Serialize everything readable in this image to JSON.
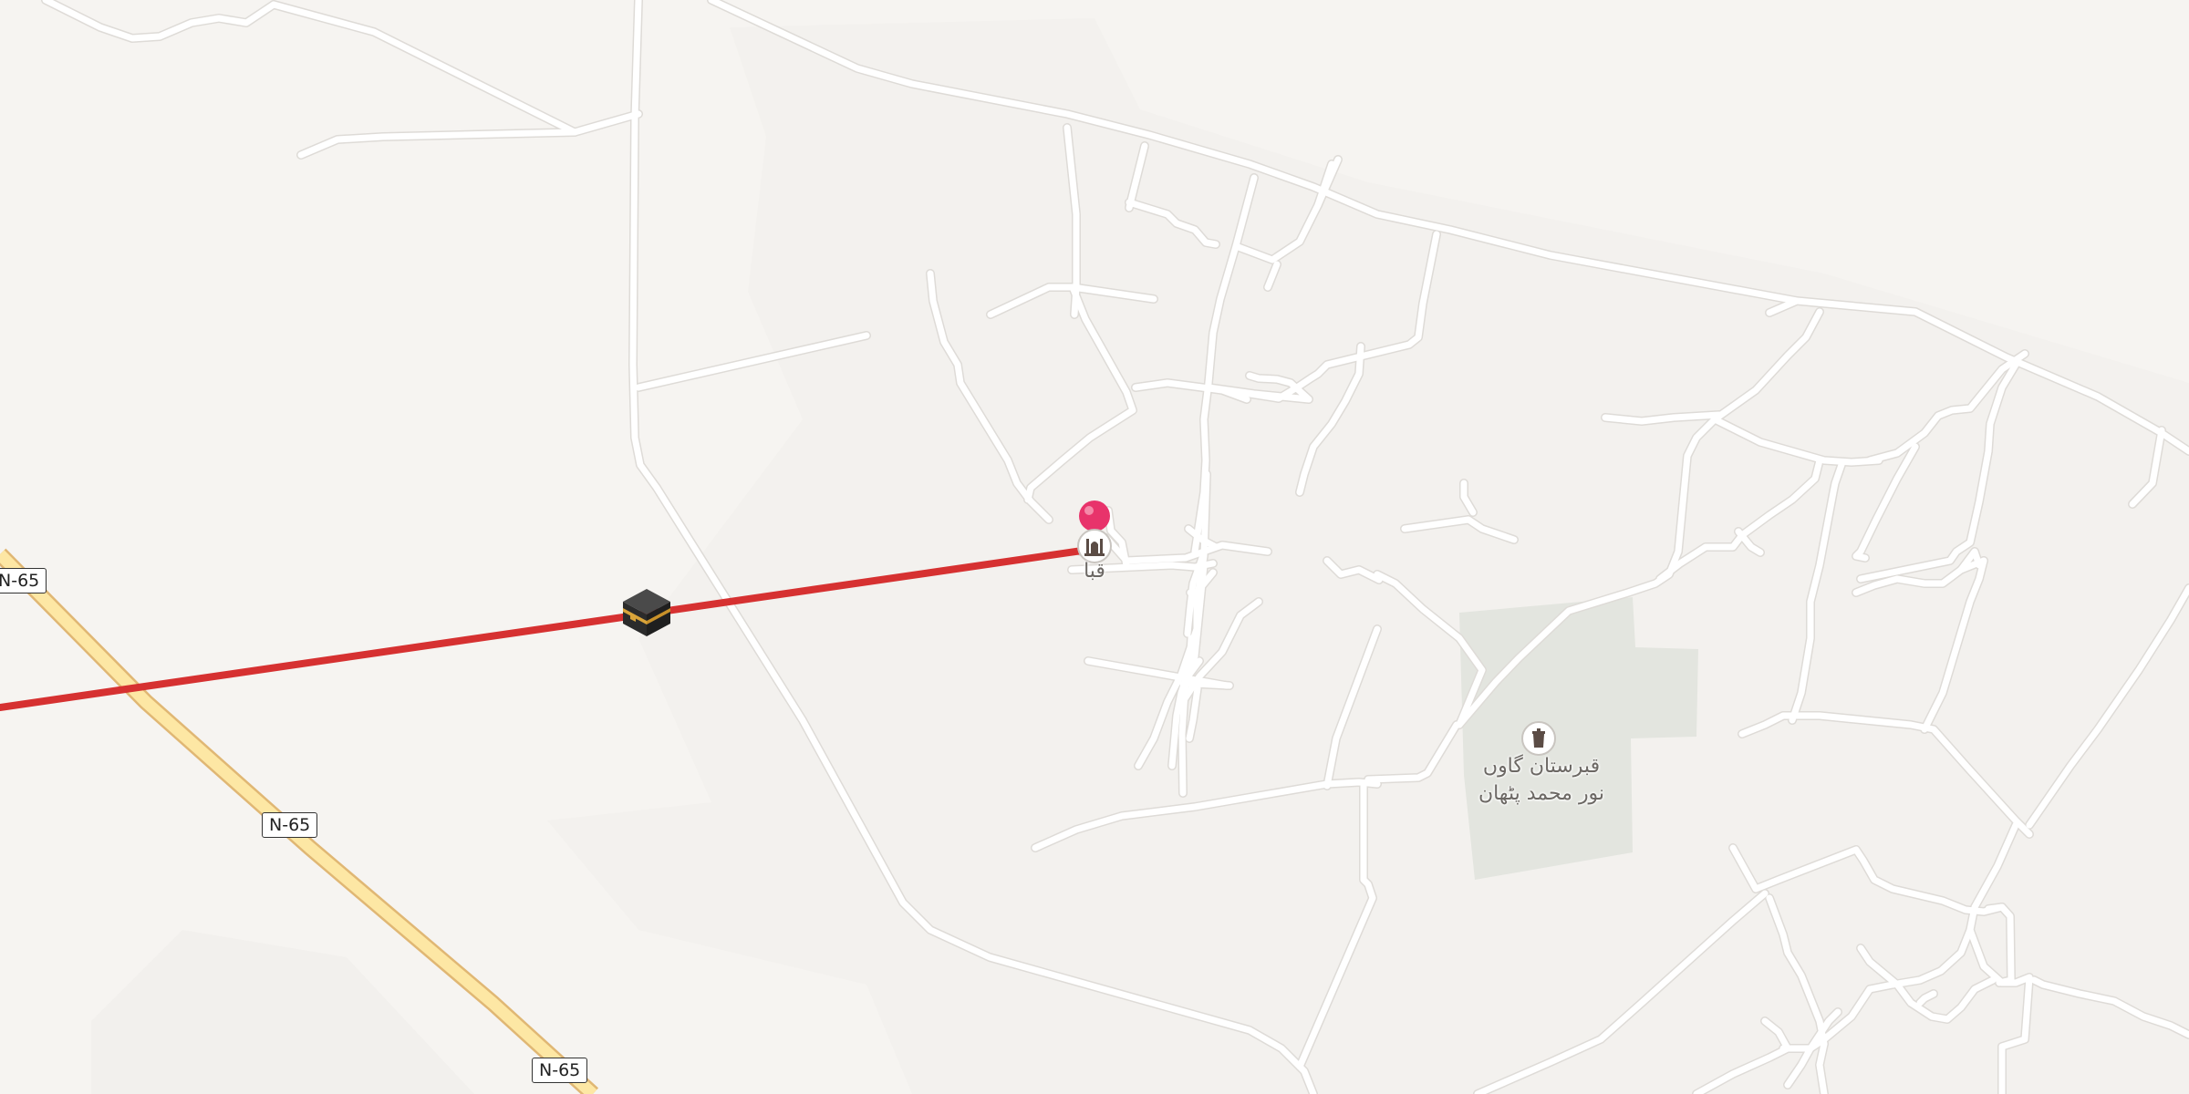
{
  "map": {
    "colors": {
      "background": "#f6f4f1",
      "route": "#d63131",
      "highway": "#fde7a4",
      "highway_casing": "#e0b774",
      "cemetery_area": "#e3e5df",
      "pin": "#e8336b"
    },
    "shields": [
      {
        "id": "shield-west",
        "label": "N-65"
      },
      {
        "id": "shield-middle",
        "label": "N-65"
      },
      {
        "id": "shield-south",
        "label": "N-65"
      }
    ],
    "pois": {
      "mosque": {
        "label": "قبا",
        "icon": "mosque-icon"
      },
      "cemetery": {
        "label_line1": "قبرستان گاوں",
        "label_line2": "نور محمد پٹھان",
        "icon": "grave-icon"
      },
      "qibla": {
        "icon": "kaaba-icon"
      },
      "pin": {
        "icon": "location-pin-icon"
      }
    },
    "route_line": "qibla-direction"
  }
}
